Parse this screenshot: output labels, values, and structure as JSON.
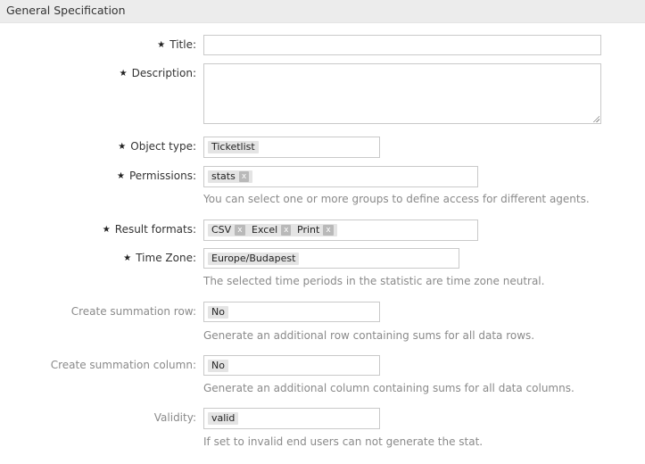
{
  "section": {
    "title": "General Specification"
  },
  "fields": {
    "title": {
      "label": "Title:",
      "required": true,
      "value": ""
    },
    "description": {
      "label": "Description:",
      "required": true,
      "value": ""
    },
    "object_type": {
      "label": "Object type:",
      "required": true,
      "value": "Ticketlist"
    },
    "permissions": {
      "label": "Permissions:",
      "required": true,
      "tokens": [
        "stats"
      ],
      "help": "You can select one or more groups to define access for different agents."
    },
    "result_formats": {
      "label": "Result formats:",
      "required": true,
      "tokens": [
        "CSV",
        "Excel",
        "Print"
      ]
    },
    "time_zone": {
      "label": "Time Zone:",
      "required": true,
      "value": "Europe/Budapest",
      "help": "The selected time periods in the statistic are time zone neutral."
    },
    "summation_row": {
      "label": "Create summation row:",
      "required": false,
      "value": "No",
      "help": "Generate an additional row containing sums for all data rows."
    },
    "summation_column": {
      "label": "Create summation column:",
      "required": false,
      "value": "No",
      "help": "Generate an additional column containing sums for all data columns."
    },
    "validity": {
      "label": "Validity:",
      "required": false,
      "value": "valid",
      "help": "If set to invalid end users can not generate the stat."
    }
  },
  "glyphs": {
    "required_marker": "★",
    "remove": "x"
  }
}
